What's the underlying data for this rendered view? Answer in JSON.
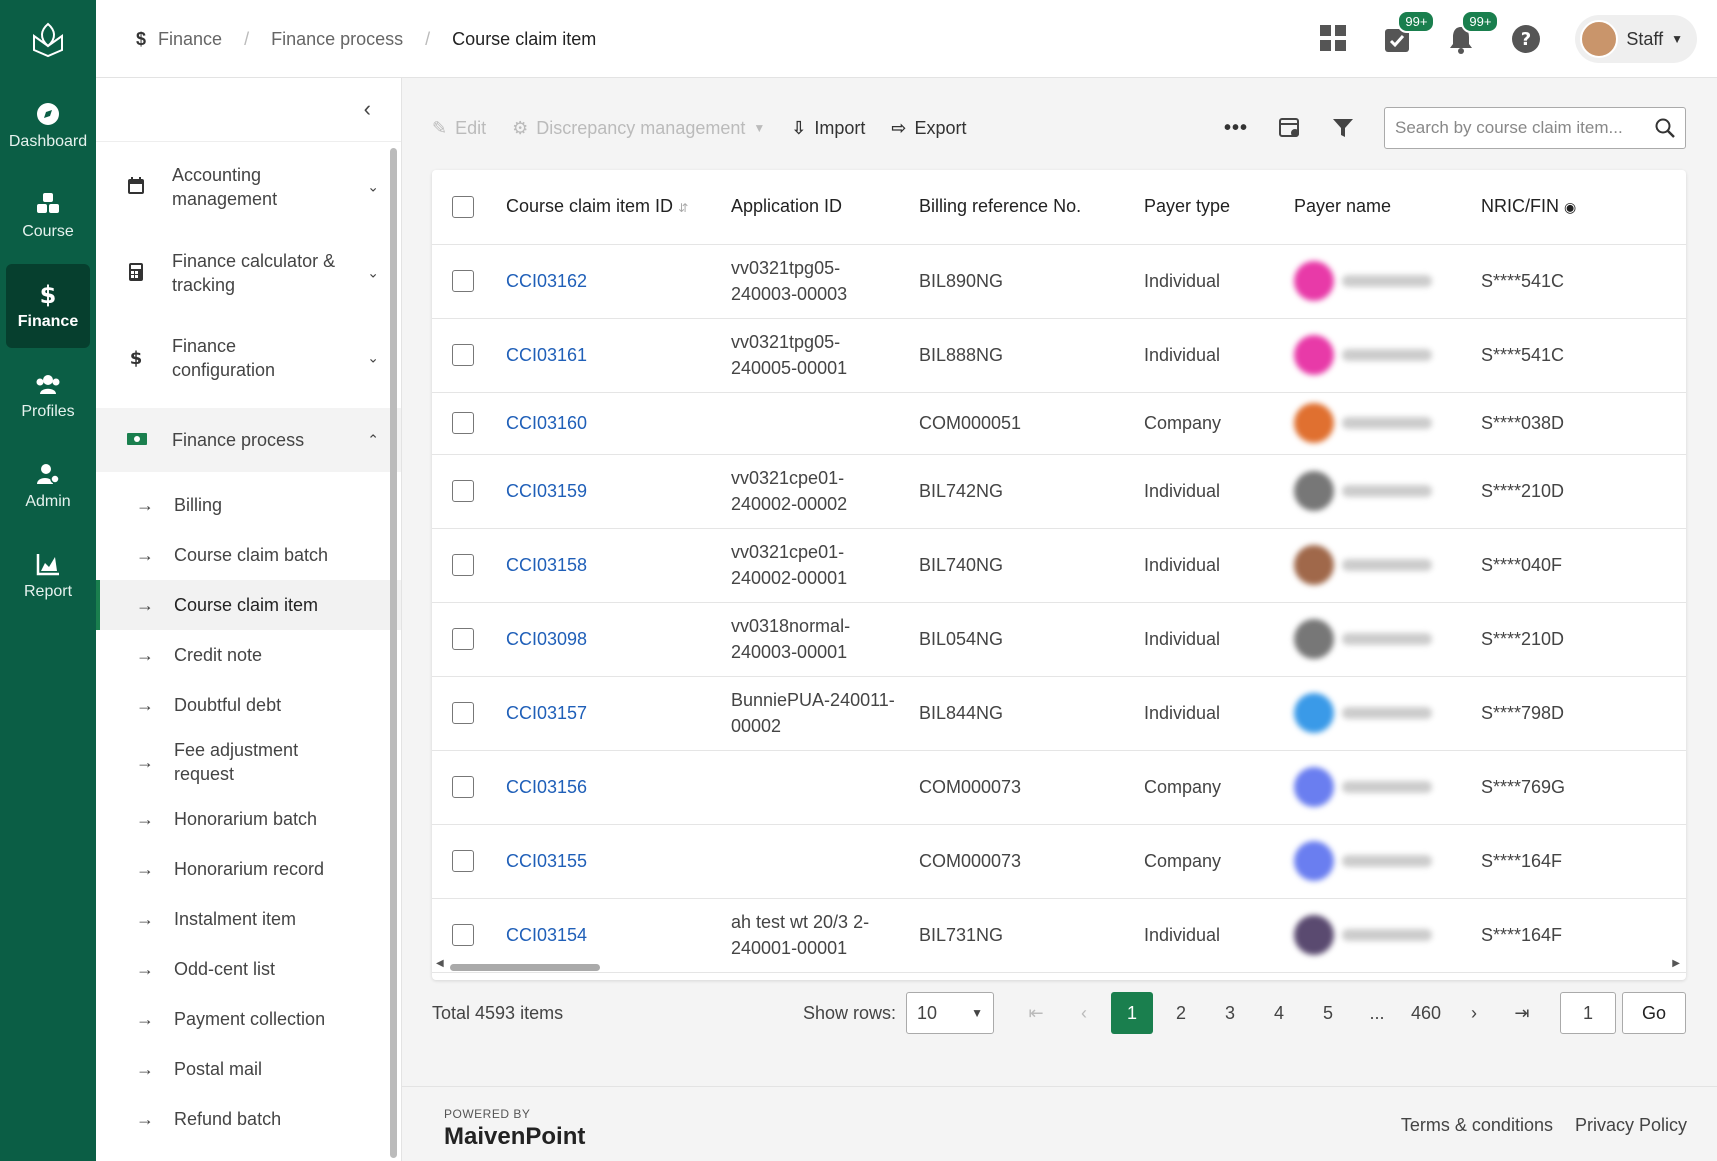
{
  "rail": {
    "items": [
      {
        "label": "Dashboard",
        "icon": "compass-icon",
        "active": false
      },
      {
        "label": "Course",
        "icon": "cubes-icon",
        "active": false
      },
      {
        "label": "Finance",
        "icon": "dollar-icon",
        "active": true
      },
      {
        "label": "Profiles",
        "icon": "users-icon",
        "active": false
      },
      {
        "label": "Admin",
        "icon": "user-gear-icon",
        "active": false
      },
      {
        "label": "Report",
        "icon": "chart-icon",
        "active": false
      }
    ]
  },
  "breadcrumb": [
    "Finance",
    "Finance process",
    "Course claim item"
  ],
  "header": {
    "tasks_badge": "99+",
    "notifications_badge": "99+",
    "user": "Staff"
  },
  "nav": {
    "groups": [
      {
        "label": "Accounting management",
        "icon": "calendar-icon"
      },
      {
        "label": "Finance calculator & tracking",
        "icon": "calculator-icon"
      },
      {
        "label": "Finance configuration",
        "icon": "dollar-icon"
      },
      {
        "label": "Finance process",
        "icon": "money-icon"
      }
    ],
    "sub_items": [
      "Billing",
      "Course claim batch",
      "Course claim item",
      "Credit note",
      "Doubtful debt",
      "Fee adjustment request",
      "Honorarium batch",
      "Honorarium record",
      "Instalment item",
      "Odd-cent list",
      "Payment collection",
      "Postal mail",
      "Refund batch"
    ],
    "active_sub": "Course claim item"
  },
  "toolbar": {
    "edit": "Edit",
    "discrepancy": "Discrepancy management",
    "import": "Import",
    "export": "Export",
    "search_placeholder": "Search by course claim item..."
  },
  "table": {
    "columns": [
      "Course claim item ID",
      "Application ID",
      "Billing reference No.",
      "Payer type",
      "Payer name",
      "NRIC/FIN"
    ],
    "rows": [
      {
        "id": "CCI03162",
        "app": "vv0321tpg05-240003-00003",
        "bill": "BIL890NG",
        "type": "Individual",
        "nric": "S****541C",
        "color": "#e83aa8"
      },
      {
        "id": "CCI03161",
        "app": "vv0321tpg05-240005-00001",
        "bill": "BIL888NG",
        "type": "Individual",
        "nric": "S****541C",
        "color": "#e83aa8"
      },
      {
        "id": "CCI03160",
        "app": "",
        "bill": "COM000051",
        "type": "Company",
        "nric": "S****038D",
        "color": "#e07030"
      },
      {
        "id": "CCI03159",
        "app": "vv0321cpe01-240002-00002",
        "bill": "BIL742NG",
        "type": "Individual",
        "nric": "S****210D",
        "color": "#777777"
      },
      {
        "id": "CCI03158",
        "app": "vv0321cpe01-240002-00001",
        "bill": "BIL740NG",
        "type": "Individual",
        "nric": "S****040F",
        "color": "#a0684a"
      },
      {
        "id": "CCI03098",
        "app": "vv0318normal-240003-00001",
        "bill": "BIL054NG",
        "type": "Individual",
        "nric": "S****210D",
        "color": "#777777"
      },
      {
        "id": "CCI03157",
        "app": "BunniePUA-240011-00002",
        "bill": "BIL844NG",
        "type": "Individual",
        "nric": "S****798D",
        "color": "#3a9ae8"
      },
      {
        "id": "CCI03156",
        "app": "",
        "bill": "COM000073",
        "type": "Company",
        "nric": "S****769G",
        "color": "#6a7ef0"
      },
      {
        "id": "CCI03155",
        "app": "",
        "bill": "COM000073",
        "type": "Company",
        "nric": "S****164F",
        "color": "#6a7ef0"
      },
      {
        "id": "CCI03154",
        "app": "ah test wt 20/3 2-240001-00001",
        "bill": "BIL731NG",
        "type": "Individual",
        "nric": "S****164F",
        "color": "#5a4a70"
      }
    ]
  },
  "pager": {
    "total": "Total 4593 items",
    "show_rows_label": "Show rows:",
    "rows_value": "10",
    "pages": [
      "1",
      "2",
      "3",
      "4",
      "5",
      "...",
      "460"
    ],
    "current": "1",
    "jump_value": "1",
    "go": "Go"
  },
  "footer": {
    "powered": "POWERED BY",
    "brand": "MaivenPoint",
    "terms": "Terms & conditions",
    "privacy": "Privacy Policy"
  }
}
